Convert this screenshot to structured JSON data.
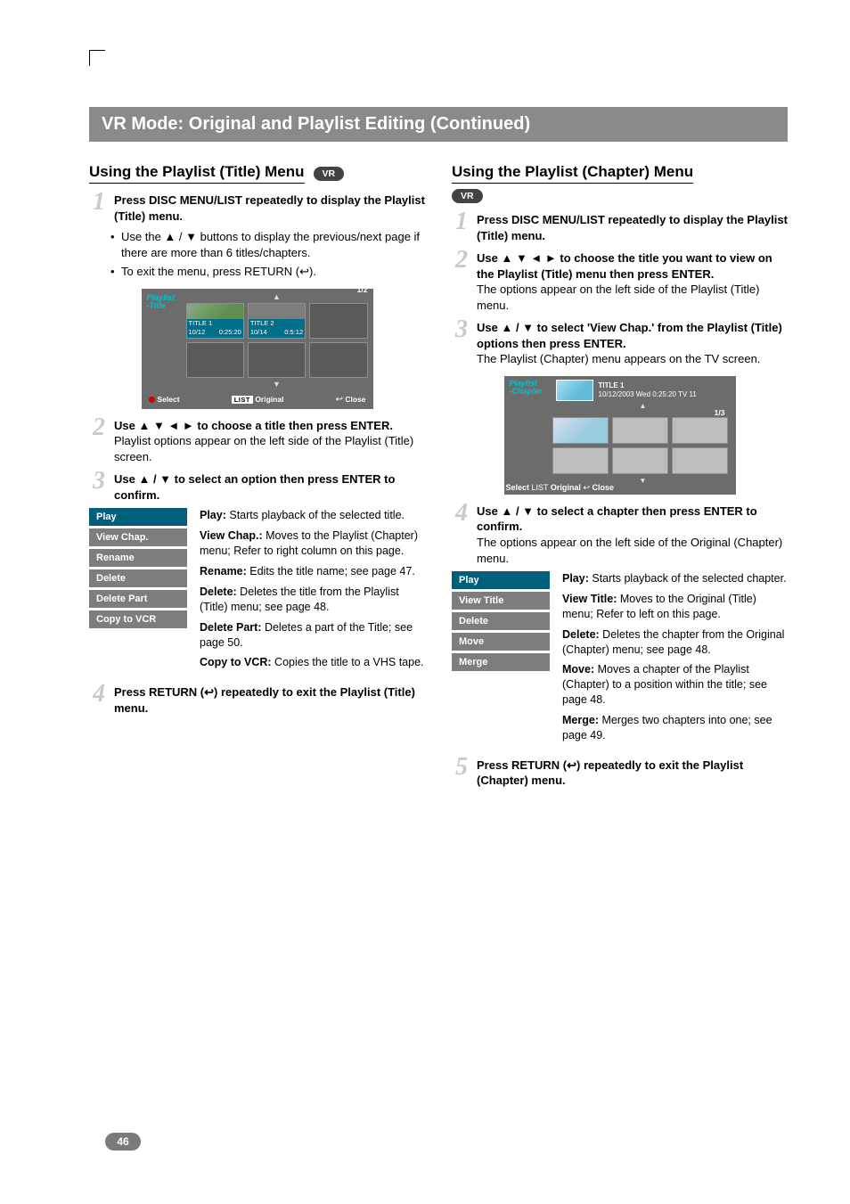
{
  "banner": "VR Mode: Original and Playlist Editing (Continued)",
  "left": {
    "title": "Using the Playlist (Title) Menu",
    "badge": "VR",
    "step1": {
      "lead": "Press DISC MENU/LIST repeatedly to display the Playlist (Title) menu.",
      "b1": "Use the ▲ / ▼ buttons to display the previous/next page if there are more than 6 titles/chapters.",
      "b2": "To exit the menu, press RETURN (↩)."
    },
    "osd": {
      "label1": "Playlist",
      "label2": "-Title",
      "page": "1/2",
      "t1name": "TITLE 1",
      "t1date": "10/12",
      "t1dur": "0:25:20",
      "t2name": "TITLE 2",
      "t2date": "10/14",
      "t2dur": "0:5:12",
      "sel": "Select",
      "list": "LIST",
      "orig": "Original",
      "close": "Close"
    },
    "step2": {
      "lead": "Use ▲ ▼ ◄ ► to choose a title then press ENTER.",
      "body": "Playlist options appear on the left side of the Playlist (Title) screen."
    },
    "step3": {
      "lead": "Use ▲ / ▼ to select an option then press ENTER to confirm."
    },
    "menu": {
      "i1": "Play",
      "i2": "View Chap.",
      "i3": "Rename",
      "i4": "Delete",
      "i5": "Delete Part",
      "i6": "Copy to VCR"
    },
    "desc": {
      "d1k": "Play:",
      "d1": " Starts playback of the selected title.",
      "d2k": "View Chap.:",
      "d2": " Moves to the Playlist (Chapter) menu; Refer to right column on this page.",
      "d3k": "Rename:",
      "d3": " Edits the title name; see page 47.",
      "d4k": "Delete:",
      "d4": " Deletes the title from the Playlist (Title) menu; see page 48.",
      "d5k": "Delete Part:",
      "d5": " Deletes a part of the Title; see page 50.",
      "d6k": "Copy to VCR:",
      "d6": " Copies the title to a VHS tape."
    },
    "step4": {
      "lead": "Press RETURN (↩) repeatedly to exit the Playlist (Title) menu."
    }
  },
  "right": {
    "title": "Using the Playlist (Chapter) Menu",
    "badge": "VR",
    "step1": {
      "lead": "Press DISC MENU/LIST repeatedly to display the Playlist (Title) menu."
    },
    "step2": {
      "lead": "Use ▲ ▼ ◄ ► to choose the title you want to view on the Playlist (Title) menu then press ENTER.",
      "body": "The options appear on the left side of the Playlist (Title) menu."
    },
    "step3": {
      "lead": "Use ▲ / ▼ to select 'View Chap.' from the Playlist (Title) options then press ENTER.",
      "body": "The Playlist (Chapter) menu appears on the TV screen."
    },
    "osd": {
      "label1": "Playlist",
      "label2": "-Chapter",
      "t1": "TITLE 1",
      "info": "10/12/2003  Wed  0:25:20  TV 11",
      "page": "1/3",
      "sel": "Select",
      "list": "LIST",
      "orig": "Original",
      "close": "Close"
    },
    "step4": {
      "lead": "Use ▲ / ▼ to select a chapter then press ENTER to confirm.",
      "body": "The options appear on the left side of the Original (Chapter) menu."
    },
    "menu": {
      "i1": "Play",
      "i2": "View Title",
      "i3": "Delete",
      "i4": "Move",
      "i5": "Merge"
    },
    "desc": {
      "d1k": "Play:",
      "d1": " Starts playback of the selected chapter.",
      "d2k": "View Title:",
      "d2": " Moves to the Original (Title) menu; Refer to left on this page.",
      "d3k": "Delete:",
      "d3": " Deletes the chapter from the Original (Chapter) menu; see page 48.",
      "d4k": "Move:",
      "d4": " Moves a chapter of the Playlist (Chapter) to a position within the title; see page 48.",
      "d5k": "Merge:",
      "d5": " Merges two chapters into one; see page 49."
    },
    "step5": {
      "lead": "Press RETURN (↩) repeatedly to exit the Playlist (Chapter) menu."
    }
  },
  "page_num": "46"
}
